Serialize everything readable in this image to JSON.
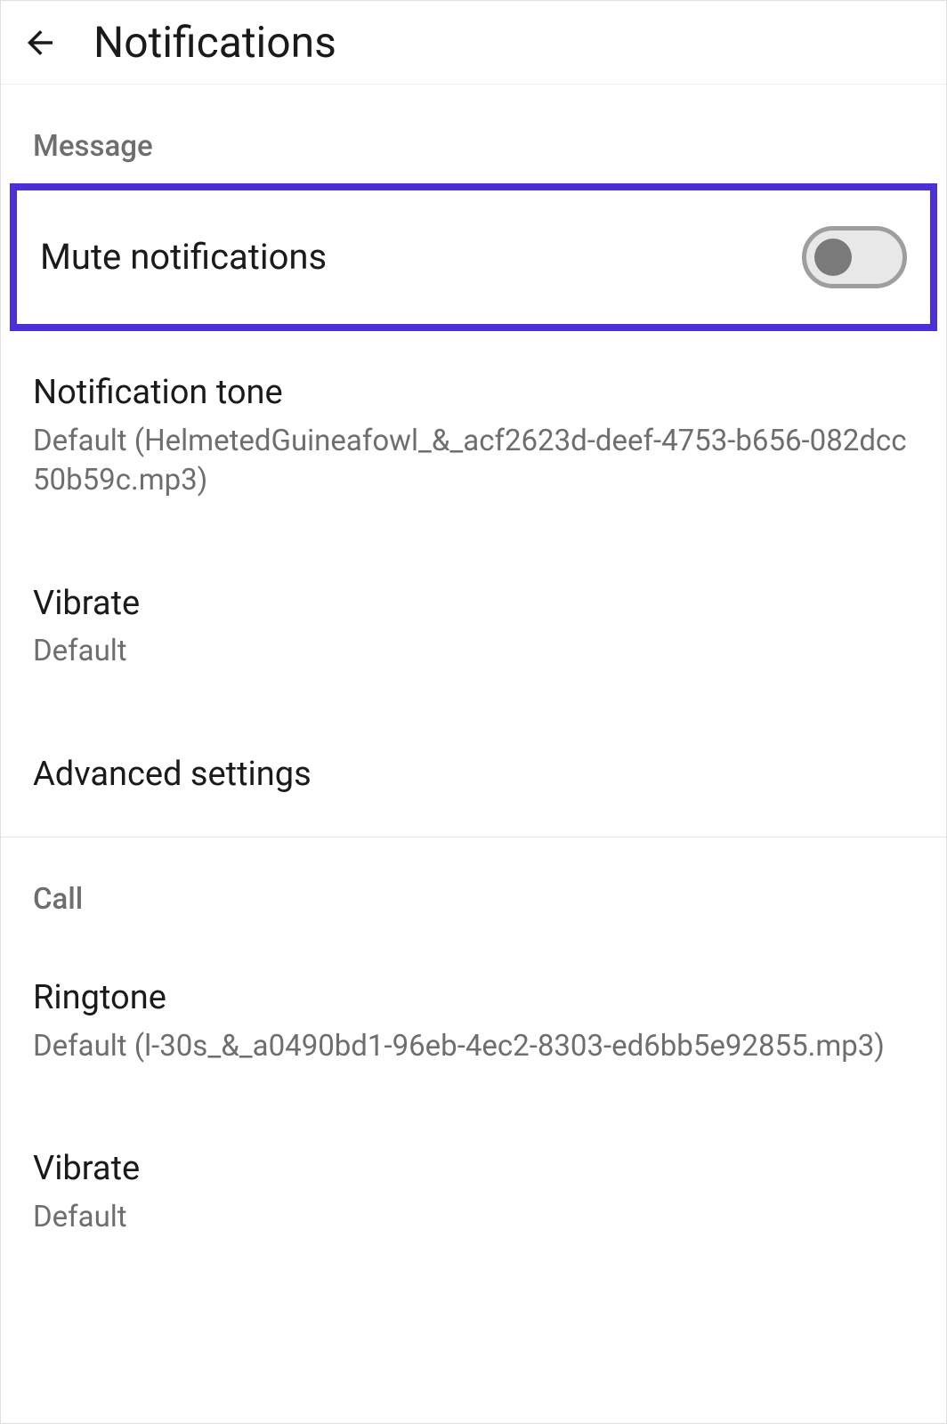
{
  "header": {
    "title": "Notifications"
  },
  "sections": {
    "message": {
      "label": "Message",
      "mute": {
        "title": "Mute notifications",
        "on": false
      },
      "tone": {
        "title": "Notification tone",
        "sub": "Default (HelmetedGuineafowl_&_acf2623d-deef-4753-b656-082dcc50b59c.mp3)"
      },
      "vibrate": {
        "title": "Vibrate",
        "sub": "Default"
      },
      "advanced": {
        "title": "Advanced settings"
      }
    },
    "call": {
      "label": "Call",
      "ringtone": {
        "title": "Ringtone",
        "sub": "Default (l-30s_&_a0490bd1-96eb-4ec2-8303-ed6bb5e92855.mp3)"
      },
      "vibrate": {
        "title": "Vibrate",
        "sub": "Default"
      }
    }
  },
  "colors": {
    "highlight": "#4d2fd8"
  }
}
